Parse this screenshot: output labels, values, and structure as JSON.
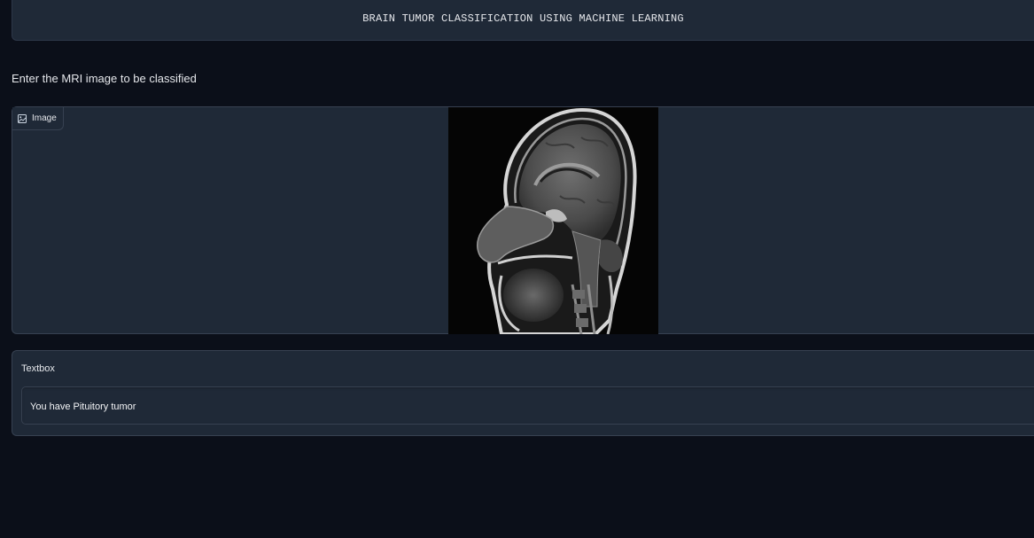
{
  "header": {
    "title": "BRAIN TUMOR CLASSIFICATION USING MACHINE LEARNING"
  },
  "instruction": "Enter the MRI image to be classified",
  "image_input": {
    "label": "Image",
    "icon": "image-icon",
    "content": "sagittal brain MRI scan"
  },
  "textbox": {
    "label": "Textbox",
    "value": "You have Pituitory tumor"
  },
  "colors": {
    "background": "#0b0f19",
    "panel": "#1f2937",
    "border": "#374151",
    "text": "#e5e7eb"
  }
}
